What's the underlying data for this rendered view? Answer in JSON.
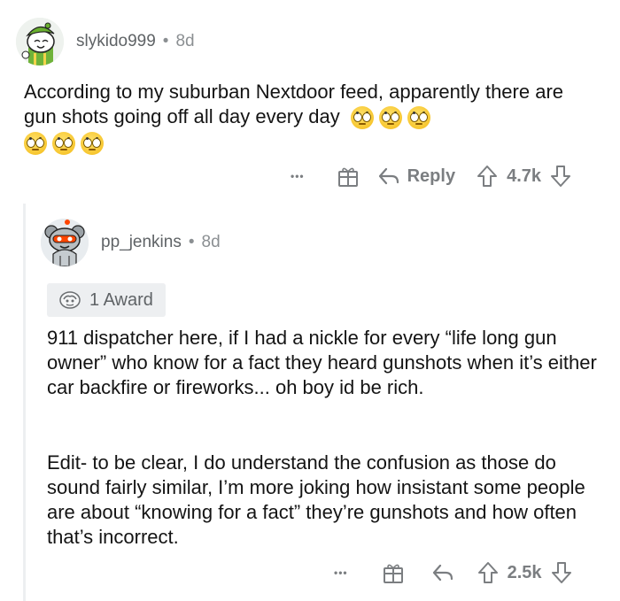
{
  "comment1": {
    "username": "slykido999",
    "separator": "•",
    "time": "8d",
    "text": "According to my suburban Nextdoor feed, apparently there are gun shots going off all day every day",
    "emojis": [
      "eye-roll",
      "eye-roll",
      "eye-roll",
      "eye-roll",
      "eye-roll",
      "eye-roll"
    ],
    "actions": {
      "more": "•••",
      "reply": "Reply",
      "score": "4.7k"
    }
  },
  "comment2": {
    "username": "pp_jenkins",
    "separator": "•",
    "time": "8d",
    "award": "1 Award",
    "paragraph1": "911 dispatcher here, if I had a nickle for every “life long gun owner” who know for a fact they heard gunshots when it’s either car backfire or fireworks... oh boy id be rich.",
    "paragraph2": "Edit- to be clear, I do understand the confusion as those do sound fairly similar, I’m more joking how insistant some people are about “knowing for a fact” they’re gunshots and how often that’s incorrect.",
    "actions": {
      "more": "•••",
      "score": "2.5k"
    }
  },
  "colors": {
    "text": "#141414",
    "meta": "#8b8f92",
    "icon": "#7b7e81",
    "thread": "#edeff1",
    "award_bg": "#edeff1"
  }
}
